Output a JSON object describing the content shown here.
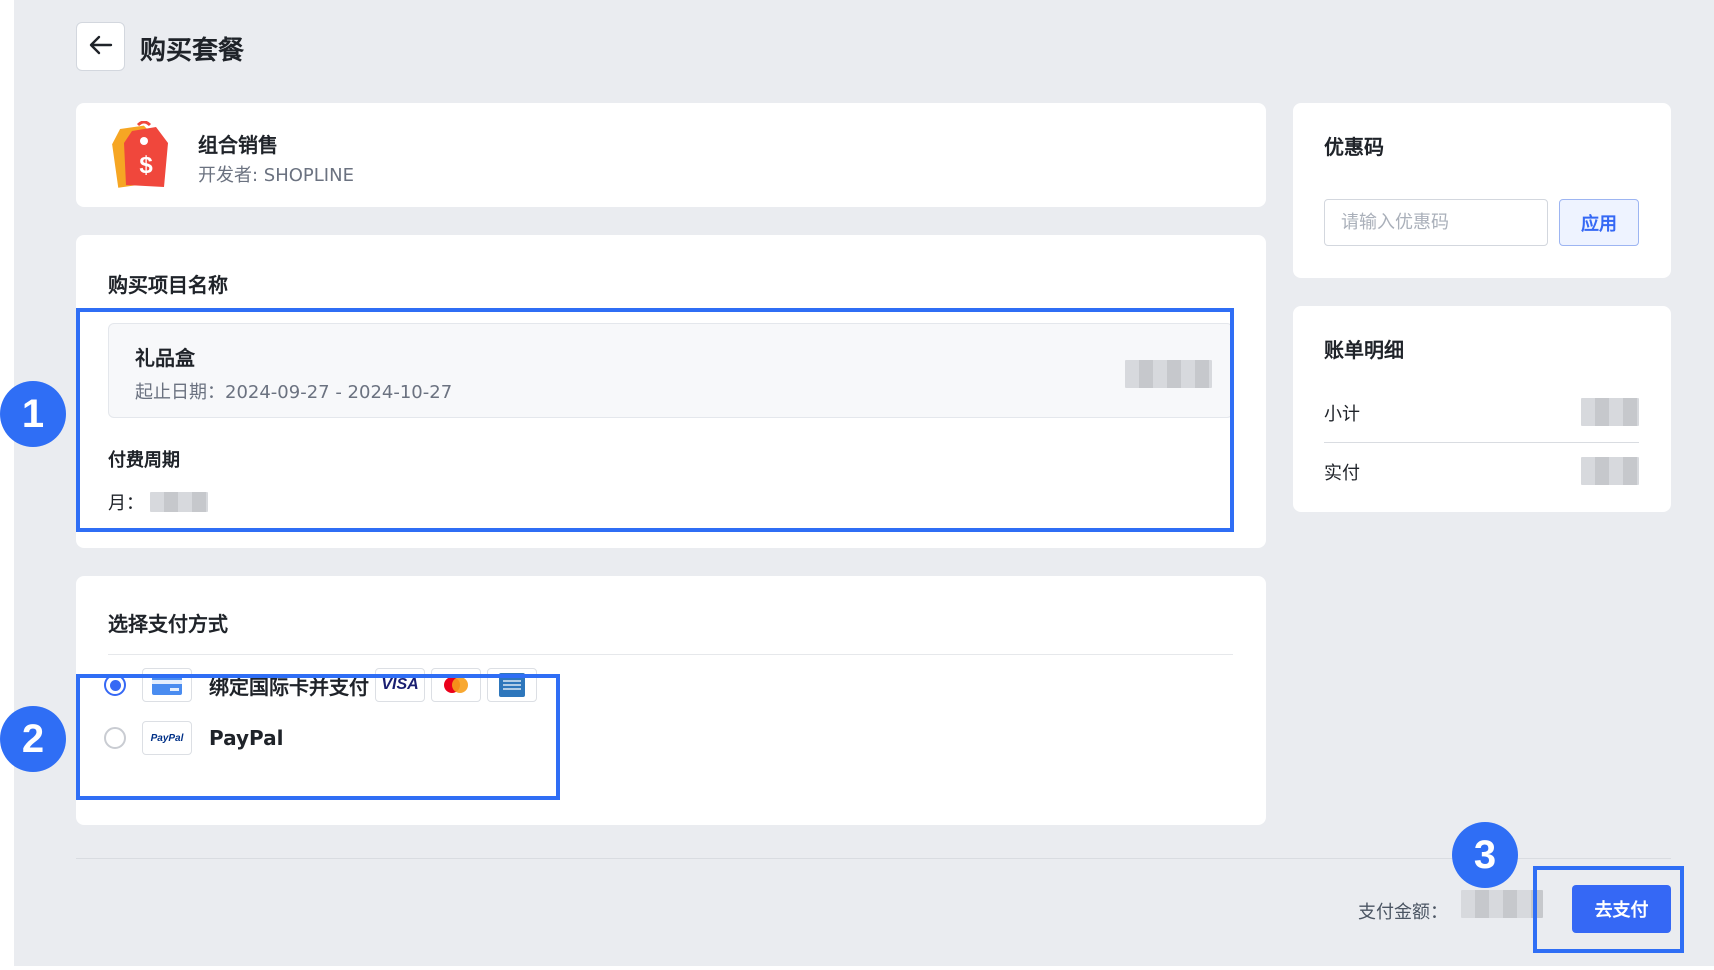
{
  "header": {
    "title": "购买套餐",
    "back_icon": "arrow-left-icon"
  },
  "app": {
    "icon": "shopping-tag-dollar-icon",
    "name": "组合销售",
    "developer": "开发者: SHOPLINE"
  },
  "purchase": {
    "section_title": "购买项目名称",
    "item_name": "礼品盒",
    "item_dates": "起止日期：2024-09-27 - 2024-10-27",
    "item_price": "",
    "billing_label": "付费周期",
    "billing_value_prefix": "月：",
    "billing_value": ""
  },
  "payment": {
    "section_title": "选择支付方式",
    "methods": [
      {
        "label": "绑定国际卡并支付",
        "selected": true,
        "icon": "credit-card-icon",
        "brands": [
          "VISA",
          "mastercard-icon",
          "amex-icon"
        ]
      },
      {
        "label": "PayPal",
        "selected": false,
        "icon": "paypal-logo-icon",
        "logo_text": "PayPal"
      }
    ]
  },
  "coupon": {
    "title": "优惠码",
    "placeholder": "请输入优惠码",
    "apply_label": "应用"
  },
  "bill": {
    "title": "账单明细",
    "subtotal_label": "小计",
    "total_label": "实付",
    "subtotal_value": "",
    "total_value": ""
  },
  "footer": {
    "amount_label": "支付金额：",
    "amount_value": "",
    "pay_button": "去支付"
  },
  "annotations": {
    "markers": [
      "1",
      "2",
      "3"
    ],
    "color": "#2f6ef5"
  },
  "colors": {
    "primary": "#3568f5",
    "background": "#eaecf0",
    "card": "#ffffff"
  }
}
